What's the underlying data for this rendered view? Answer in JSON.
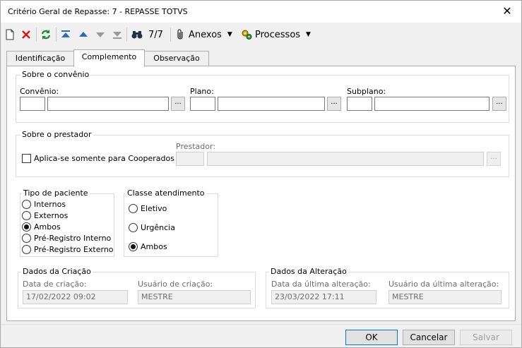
{
  "window": {
    "title": "Critério Geral de Repasse: 7 - REPASSE TOTVS"
  },
  "toolbar": {
    "items": [
      {
        "name": "new-document-icon"
      },
      {
        "name": "delete-icon"
      },
      {
        "name": "refresh-icon"
      },
      {
        "name": "first-record-icon"
      },
      {
        "name": "previous-record-icon"
      },
      {
        "name": "next-record-icon"
      },
      {
        "name": "last-record-icon"
      },
      {
        "name": "binoculars-icon"
      }
    ],
    "record_counter": "7/7",
    "anexos_label": "Anexos",
    "processos_label": "Processos"
  },
  "tabs": [
    "Identificação",
    "Complemento",
    "Observação"
  ],
  "convenio_group": {
    "title": "Sobre o convênio",
    "convenio_label": "Convênio:",
    "plano_label": "Plano:",
    "subplano_label": "Subplano:",
    "lookup_button": "..."
  },
  "prestador_group": {
    "title": "Sobre o prestador",
    "checkbox_label": "Aplica-se somente para Cooperados",
    "checkbox_checked": false,
    "prestador_label": "Prestador:"
  },
  "tipo_paciente": {
    "title": "Tipo de paciente",
    "options": [
      "Internos",
      "Externos",
      "Ambos",
      "Pré-Registro Interno",
      "Pré-Registro Externo"
    ],
    "selected": "Ambos"
  },
  "classe_atendimento": {
    "title": "Classe atendimento",
    "options": [
      "Eletivo",
      "Urgência",
      "Ambos"
    ],
    "selected": "Ambos"
  },
  "dados_criacao": {
    "title": "Dados da Criação",
    "data_label": "Data de criação:",
    "data_value": "17/02/2022 09:02",
    "usuario_label": "Usuário de criação:",
    "usuario_value": "MESTRE"
  },
  "dados_alteracao": {
    "title": "Dados da Alteração",
    "data_label": "Data da última alteração:",
    "data_value": "23/03/2022 17:11",
    "usuario_label": "Usuário da última alteração:",
    "usuario_value": "MESTRE"
  },
  "buttons": {
    "ok": "OK",
    "cancel": "Cancelar",
    "save": "Salvar"
  }
}
